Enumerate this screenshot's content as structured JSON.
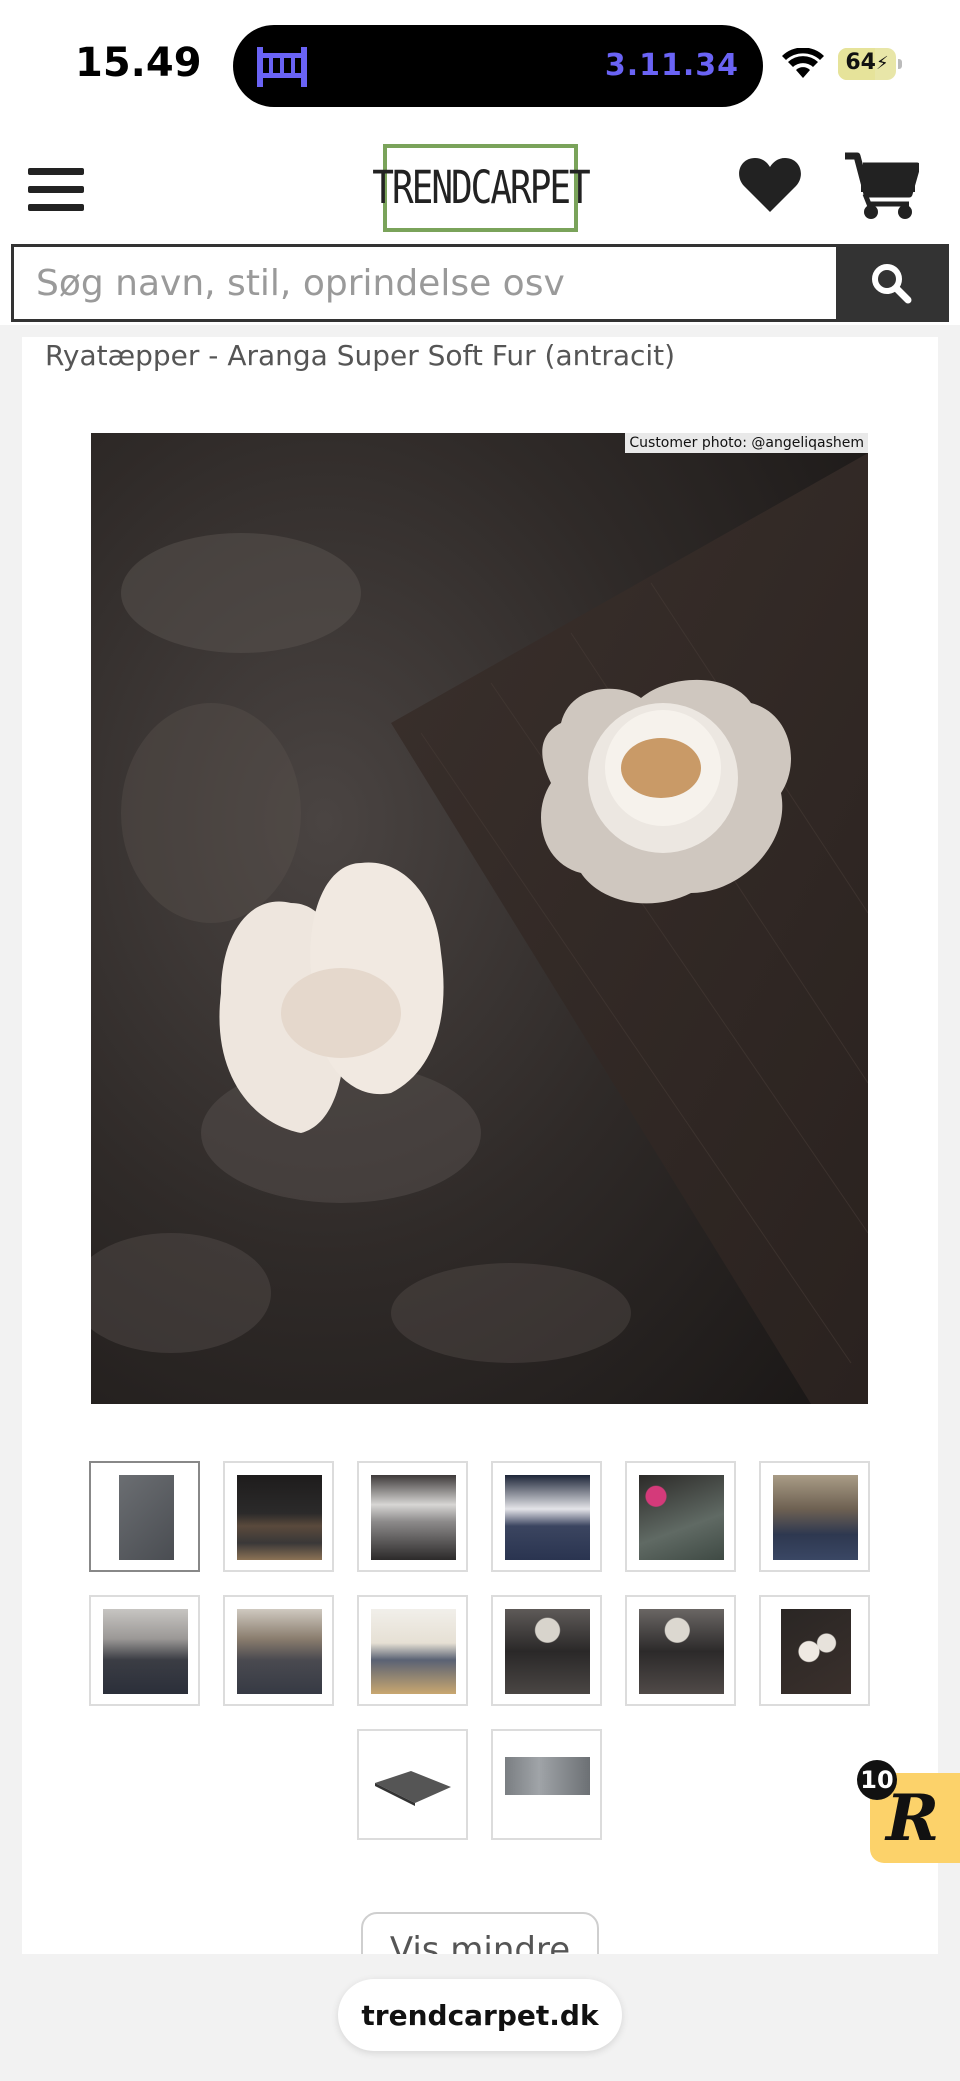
{
  "status_bar": {
    "time": "15.49",
    "activity_time": "3.11.34",
    "battery_level": "64",
    "icons": [
      "bed-icon",
      "wifi-icon",
      "battery-icon"
    ]
  },
  "header": {
    "logo_text": "TRENDCARPET",
    "icons": [
      "menu-icon",
      "heart-icon",
      "cart-icon"
    ]
  },
  "search": {
    "placeholder": "Søg navn, stil, oprindelse osv",
    "value": "",
    "button_icon": "search-icon"
  },
  "product": {
    "breadcrumb": "Ryatæpper - Aranga Super Soft Fur (antracit)",
    "photo_credit": "Customer photo: @angeliqashem",
    "thumbnail_count": 14,
    "active_thumbnail": 1,
    "toggle_label": "Vis mindre"
  },
  "widget": {
    "letter": "R",
    "count": "10"
  },
  "browser": {
    "url": "trendcarpet.dk"
  },
  "colors": {
    "logo_border": "#7aa35a",
    "island_accent": "#6a63f5",
    "widget_bg": "#fcd26a",
    "search_button": "#333333"
  }
}
